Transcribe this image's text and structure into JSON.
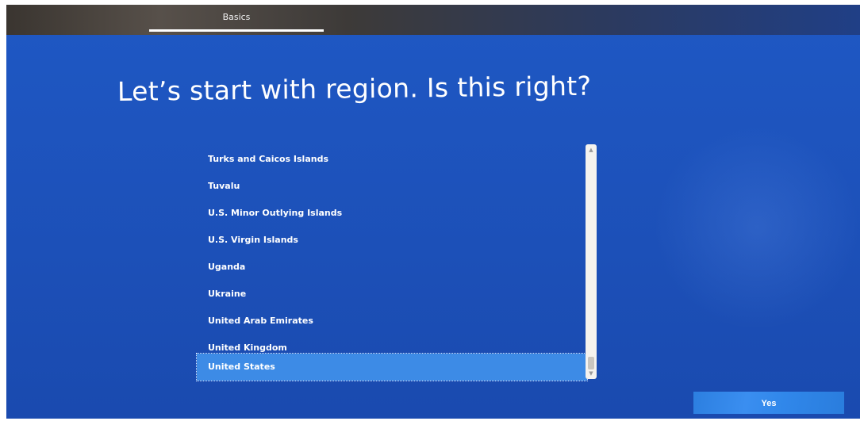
{
  "header": {
    "tabs": [
      {
        "label": "Basics",
        "active": true
      }
    ]
  },
  "page": {
    "title": "Let’s start with region. Is this right?"
  },
  "region_list": {
    "items": [
      "Turks and Caicos Islands",
      "Tuvalu",
      "U.S. Minor Outlying Islands",
      "U.S. Virgin Islands",
      "Uganda",
      "Ukraine",
      "United Arab Emirates",
      "United Kingdom",
      "United States"
    ],
    "selected": "United States"
  },
  "actions": {
    "yes_label": "Yes"
  },
  "colors": {
    "background": "#1d52bb",
    "selection": "#3d8be6",
    "button": "#3087ea"
  },
  "icons": {
    "scroll_up": "scroll-up-arrow-icon",
    "scroll_down": "scroll-down-arrow-icon"
  }
}
